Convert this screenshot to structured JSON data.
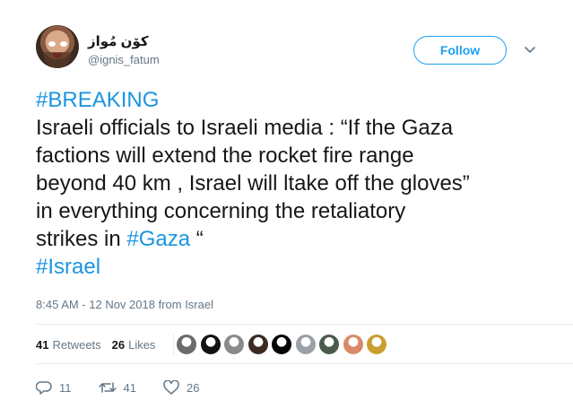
{
  "user": {
    "display_name": "كۆن مُواز",
    "handle": "@ignis_fatum",
    "avatar_icon": "user-avatar-photo"
  },
  "follow_label": "Follow",
  "tweet": {
    "hashtag_breaking": "#BREAKING",
    "line1": "Israeli officials to Israeli media : “If the Gaza",
    "line2": "factions will extend the rocket fire range",
    "line3": "beyond 40 km , Israel will ltake off the gloves”",
    "line4": "in everything concerning the retaliatory",
    "line5_text": "strikes in ",
    "hashtag_gaza": "#Gaza",
    "line5_end": " “",
    "hashtag_israel": "#Israel"
  },
  "meta": "8:45 AM - 12 Nov 2018 from Israel",
  "stats": {
    "retweets_count": "41",
    "retweets_label": "Retweets",
    "likes_count": "26",
    "likes_label": "Likes"
  },
  "actions": {
    "replies": "11",
    "retweets": "41",
    "likes": "26"
  },
  "colors": {
    "accent": "#1da1f2",
    "hashtag": "#1b95e0",
    "secondary_text": "#657786",
    "divider": "#e6ecf0"
  },
  "liker_avatars": [
    "#6b6b6b",
    "#111111",
    "#8a8a8a",
    "#3a2a22",
    "#050505",
    "#9aa0a6",
    "#4a5b4a",
    "#d98a6a",
    "#c9a030"
  ]
}
